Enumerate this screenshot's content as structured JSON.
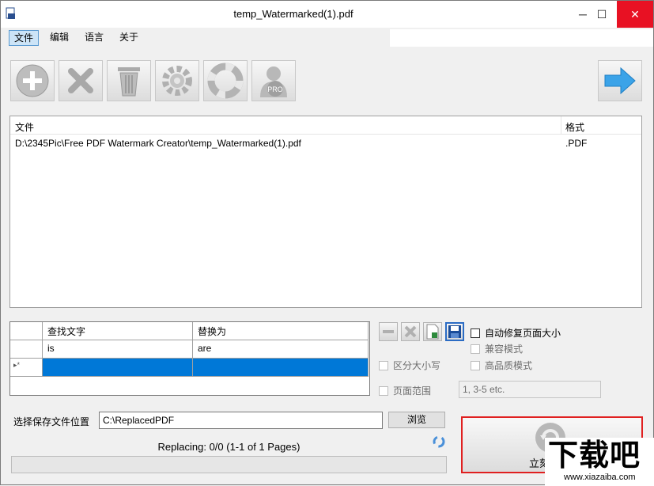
{
  "window": {
    "title": "temp_Watermarked(1).pdf",
    "minimize": "─",
    "maximize": "☐",
    "close": "✕"
  },
  "menu": [
    "文件",
    "编辑",
    "语言",
    "关于"
  ],
  "toolbar": [
    "add-icon",
    "remove-icon",
    "trash-icon",
    "settings-icon",
    "help-icon",
    "pro-icon",
    "next-arrow-icon"
  ],
  "toolbar_pro_label": "PRO",
  "file_list": {
    "columns": [
      "文件",
      "格式"
    ],
    "rows": [
      {
        "file": "D:\\2345Pic\\Free PDF Watermark Creator\\temp_Watermarked(1).pdf",
        "format": ".PDF"
      }
    ]
  },
  "replace_grid": {
    "columns": [
      "查找文字",
      "替换为"
    ],
    "rows": [
      {
        "find": "is",
        "replace": "are"
      }
    ],
    "new_row_marker": "▸*"
  },
  "options": {
    "auto_fix_page_size": "自动修复页面大小",
    "compat_mode": "兼容模式",
    "match_case": "区分大小写",
    "high_quality": "高品质模式",
    "page_range": "页面范围",
    "page_range_placeholder": "1, 3-5 etc."
  },
  "save": {
    "label": "选择保存文件位置",
    "path": "C:\\ReplacedPDF",
    "browse": "浏览"
  },
  "status": "Replacing: 0/0 (1-1 of 1 Pages)",
  "progress": 0,
  "start_button": "立刻",
  "watermark_text": {
    "main": "下载吧",
    "url": "www.xiazaiba.com"
  },
  "colors": {
    "selected_row": "#0078d7",
    "close_btn": "#e81123",
    "highlight_border": "#e02020"
  }
}
